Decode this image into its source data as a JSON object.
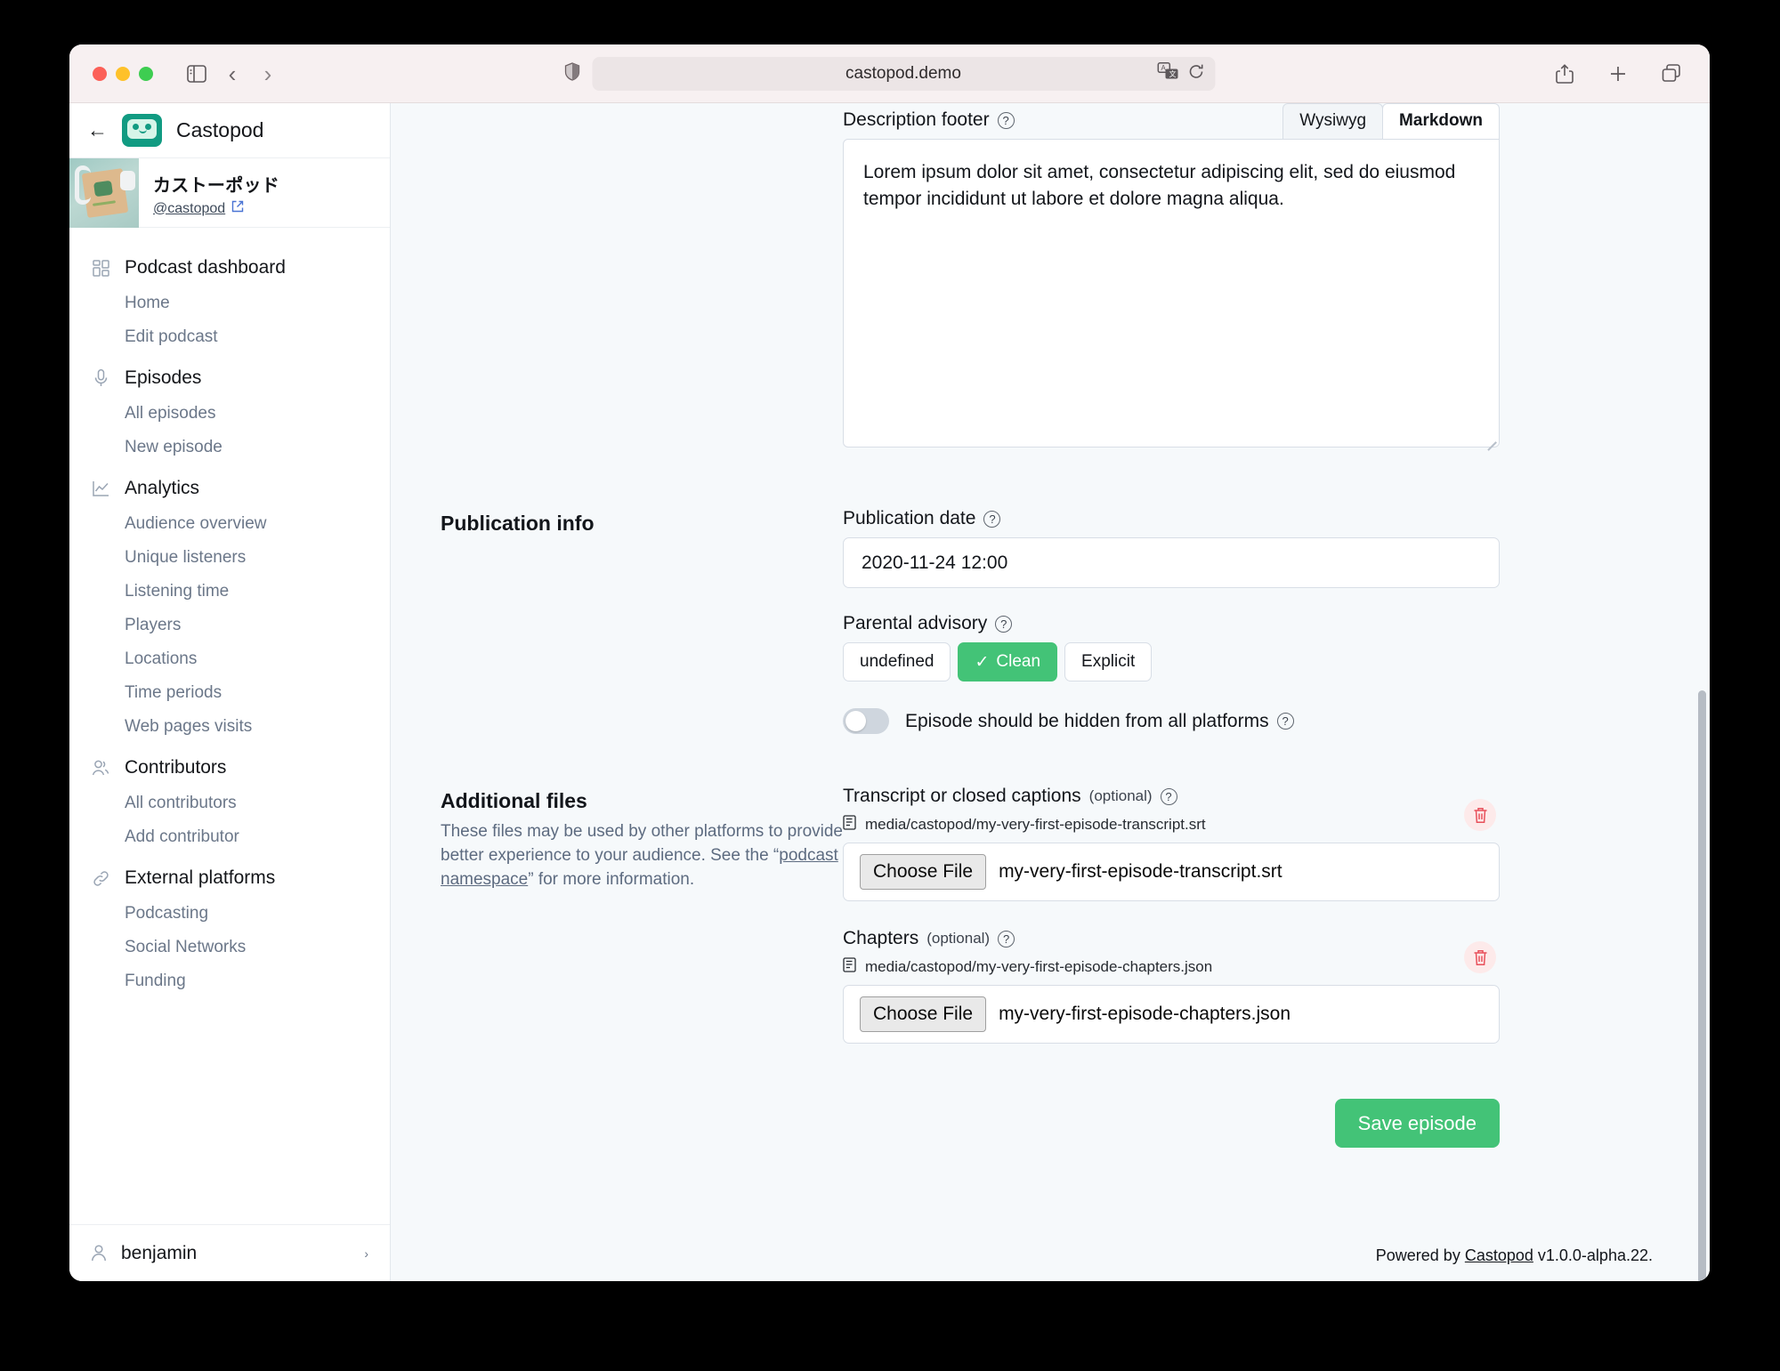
{
  "browser": {
    "url": "castopod.demo",
    "icons": {
      "sidebar_toggle": "sidebar-toggle-icon",
      "back": "back-chevron-icon",
      "forward": "forward-chevron-icon",
      "shield": "privacy-shield-icon",
      "translate": "translate-icon",
      "reload": "reload-icon",
      "share": "share-icon",
      "new_tab": "plus-icon",
      "tabs": "tabs-overview-icon"
    }
  },
  "sidebar": {
    "back_label": "←",
    "brand": "Castopod",
    "podcast": {
      "title": "カストーポッド",
      "handle": "@castopod"
    },
    "groups": [
      {
        "label": "Podcast dashboard",
        "icon": "dashboard-grid-icon",
        "items": [
          "Home",
          "Edit podcast"
        ]
      },
      {
        "label": "Episodes",
        "icon": "microphone-icon",
        "items": [
          "All episodes",
          "New episode"
        ]
      },
      {
        "label": "Analytics",
        "icon": "line-chart-icon",
        "items": [
          "Audience overview",
          "Unique listeners",
          "Listening time",
          "Players",
          "Locations",
          "Time periods",
          "Web pages visits"
        ]
      },
      {
        "label": "Contributors",
        "icon": "people-icon",
        "items": [
          "All contributors",
          "Add contributor"
        ]
      },
      {
        "label": "External platforms",
        "icon": "link-chain-icon",
        "items": [
          "Podcasting",
          "Social Networks",
          "Funding"
        ]
      }
    ],
    "user": {
      "name": "benjamin",
      "caret": "›"
    }
  },
  "main": {
    "description_footer": {
      "label": "Description footer",
      "tabs": [
        {
          "label": "Wysiwyg",
          "active": false
        },
        {
          "label": "Markdown",
          "active": true
        }
      ],
      "value": "Lorem ipsum dolor sit amet, consectetur adipiscing elit, sed do eiusmod tempor incididunt ut labore et dolore magna aliqua."
    },
    "publication_info": {
      "section_title": "Publication info",
      "date_label": "Publication date",
      "date_value": "2020-11-24 12:00",
      "advisory_label": "Parental advisory",
      "advisory_options": [
        {
          "label": "undefined",
          "selected": false
        },
        {
          "label": "Clean",
          "selected": true
        },
        {
          "label": "Explicit",
          "selected": false
        }
      ],
      "check_glyph": "✓",
      "hidden_toggle_label": "Episode should be hidden from all platforms",
      "hidden_toggle_on": false
    },
    "additional_files": {
      "section_title": "Additional files",
      "description_before": "These files may be used by other platforms to provide better experience to your audience. See the “",
      "description_link": "podcast namespace",
      "description_after": "” for more information.",
      "transcript": {
        "label": "Transcript or closed captions",
        "optional": "(optional)",
        "path": "media/castopod/my-very-first-episode-transcript.srt",
        "choose_label": "Choose File",
        "file_name": "my-very-first-episode-transcript.srt"
      },
      "chapters": {
        "label": "Chapters",
        "optional": "(optional)",
        "path": "media/castopod/my-very-first-episode-chapters.json",
        "choose_label": "Choose File",
        "file_name": "my-very-first-episode-chapters.json"
      }
    },
    "save_label": "Save episode",
    "footer": {
      "prefix": "Powered by ",
      "link": "Castopod",
      "suffix": " v1.0.0-alpha.22."
    }
  },
  "colors": {
    "accent_green": "#43c377",
    "brand_teal": "#119b82",
    "danger_red": "#e8505b"
  }
}
